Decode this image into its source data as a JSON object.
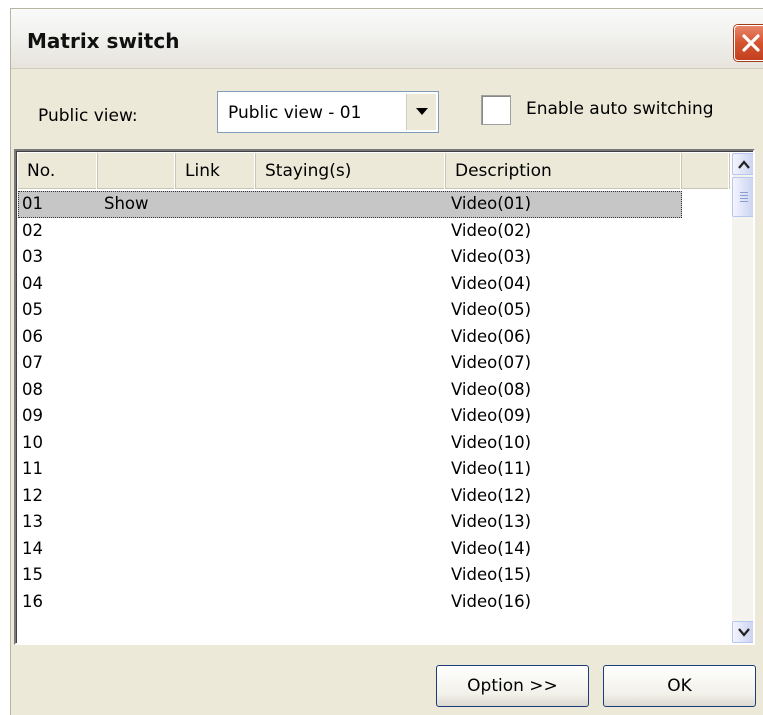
{
  "window": {
    "title": "Matrix switch"
  },
  "public_view": {
    "label": "Public view:",
    "selected": "Public view - 01"
  },
  "auto_switch": {
    "label": "Enable auto switching",
    "checked": false
  },
  "table": {
    "columns": [
      "No.",
      "",
      "Link",
      "Staying(s)",
      "Description"
    ],
    "rows": [
      {
        "no": "01",
        "status": "Show",
        "link": "",
        "staying": "",
        "description": "Video(01)"
      },
      {
        "no": "02",
        "status": "",
        "link": "",
        "staying": "",
        "description": "Video(02)"
      },
      {
        "no": "03",
        "status": "",
        "link": "",
        "staying": "",
        "description": "Video(03)"
      },
      {
        "no": "04",
        "status": "",
        "link": "",
        "staying": "",
        "description": "Video(04)"
      },
      {
        "no": "05",
        "status": "",
        "link": "",
        "staying": "",
        "description": "Video(05)"
      },
      {
        "no": "06",
        "status": "",
        "link": "",
        "staying": "",
        "description": "Video(06)"
      },
      {
        "no": "07",
        "status": "",
        "link": "",
        "staying": "",
        "description": "Video(07)"
      },
      {
        "no": "08",
        "status": "",
        "link": "",
        "staying": "",
        "description": "Video(08)"
      },
      {
        "no": "09",
        "status": "",
        "link": "",
        "staying": "",
        "description": "Video(09)"
      },
      {
        "no": "10",
        "status": "",
        "link": "",
        "staying": "",
        "description": "Video(10)"
      },
      {
        "no": "11",
        "status": "",
        "link": "",
        "staying": "",
        "description": "Video(11)"
      },
      {
        "no": "12",
        "status": "",
        "link": "",
        "staying": "",
        "description": "Video(12)"
      },
      {
        "no": "13",
        "status": "",
        "link": "",
        "staying": "",
        "description": "Video(13)"
      },
      {
        "no": "14",
        "status": "",
        "link": "",
        "staying": "",
        "description": "Video(14)"
      },
      {
        "no": "15",
        "status": "",
        "link": "",
        "staying": "",
        "description": "Video(15)"
      },
      {
        "no": "16",
        "status": "",
        "link": "",
        "staying": "",
        "description": "Video(16)"
      }
    ],
    "selected_index": 0
  },
  "buttons": {
    "option": "Option >>",
    "ok": "OK"
  },
  "icons": {
    "close": "close-icon",
    "dropdown": "chevron-down-icon",
    "scroll_up": "chevron-up-icon",
    "scroll_down": "chevron-down-icon"
  },
  "colors": {
    "close_button": "#d4542f",
    "selection": "#c6c6c6",
    "dialog_bg": "#ece9d8"
  }
}
